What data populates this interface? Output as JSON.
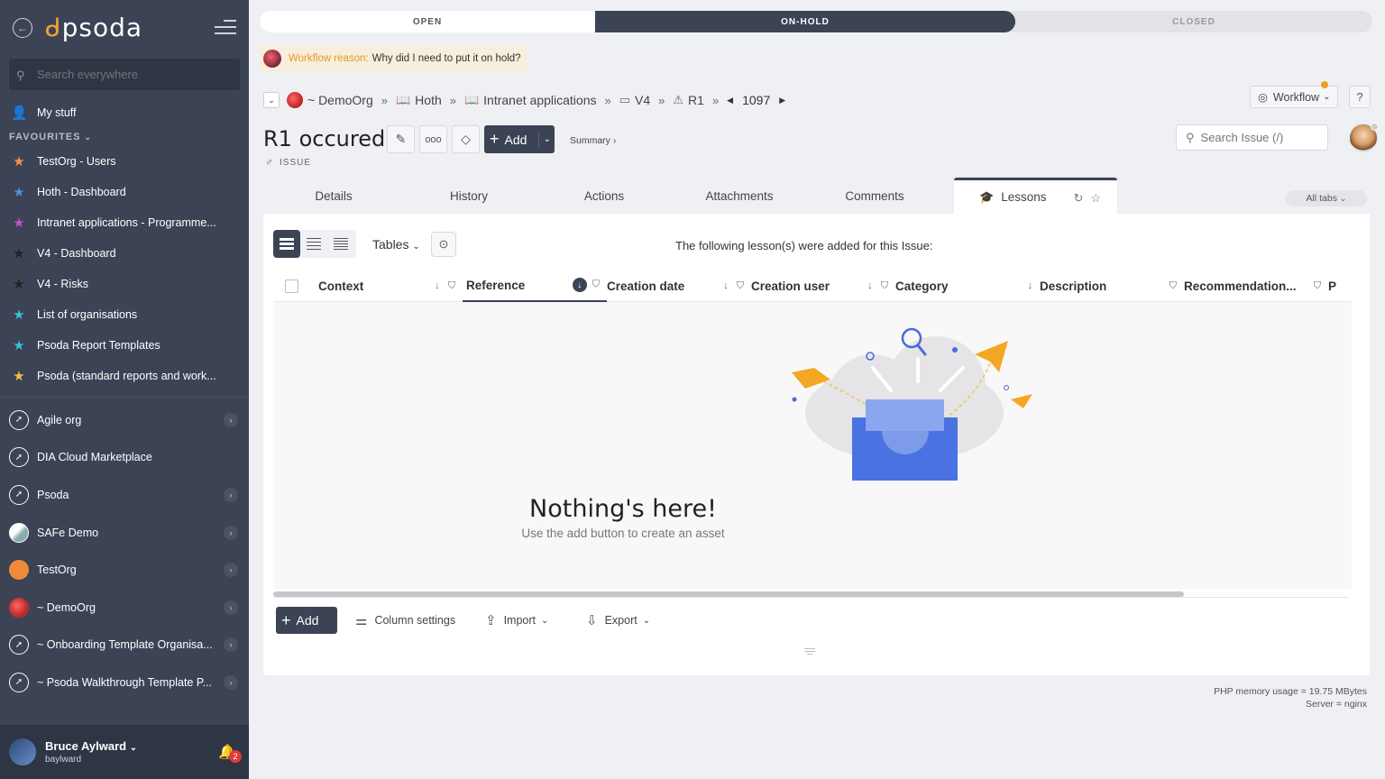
{
  "sidebar": {
    "logo": "psoda",
    "search_placeholder": "Search everywhere",
    "my_stuff": "My stuff",
    "favourites_heading": "FAVOURITES",
    "favourites": [
      {
        "label": "TestOrg - Users",
        "color": "#f0904a"
      },
      {
        "label": "Hoth - Dashboard",
        "color": "#4d8fe0"
      },
      {
        "label": "Intranet applications - Programme...",
        "color": "#c04fc8"
      },
      {
        "label": "V4 - Dashboard",
        "color": "#2a2f3a"
      },
      {
        "label": "V4 - Risks",
        "color": "#2a2f3a"
      },
      {
        "label": "List of organisations",
        "color": "#3bbfd8"
      },
      {
        "label": "Psoda Report Templates",
        "color": "#3bbfd8"
      },
      {
        "label": "Psoda (standard reports and work...",
        "color": "#f0c040"
      }
    ],
    "orgs": [
      {
        "label": "Agile org",
        "chevron": true
      },
      {
        "label": "DIA Cloud Marketplace",
        "chevron": false
      },
      {
        "label": "Psoda",
        "chevron": true
      },
      {
        "label": "SAFe Demo",
        "chevron": true
      },
      {
        "label": "TestOrg",
        "chevron": true
      },
      {
        "label": "~ DemoOrg",
        "chevron": true
      },
      {
        "label": "~ Onboarding Template Organisa...",
        "chevron": true
      },
      {
        "label": "~ Psoda Walkthrough Template P...",
        "chevron": true
      }
    ],
    "user": {
      "name": "Bruce Aylward",
      "username": "baylward",
      "notifications": "2"
    }
  },
  "workflow_stages": {
    "open": "OPEN",
    "on_hold": "ON-HOLD",
    "closed": "CLOSED"
  },
  "reason": {
    "label": "Workflow reason:",
    "text": "Why did I need to put it on hold?"
  },
  "breadcrumb": {
    "org": "~ DemoOrg",
    "items": [
      "Hoth",
      "Intranet applications",
      "V4",
      "R1"
    ],
    "number": "1097"
  },
  "header": {
    "title": "R1 occured",
    "add_label": "Add",
    "summary_link": "Summary ›",
    "type_label": "ISSUE",
    "search_placeholder": "Search Issue (/)",
    "workflow_label": "Workflow",
    "help_label": "?"
  },
  "tabs": [
    "Details",
    "History",
    "Actions",
    "Attachments",
    "Comments",
    "Lessons"
  ],
  "all_tabs": "All tabs",
  "lessons": {
    "tables_label": "Tables",
    "note": "The following lesson(s) were added for this Issue:",
    "columns": [
      "Context",
      "Reference",
      "Creation date",
      "Creation user",
      "Category",
      "Description",
      "Recommendation...",
      "P"
    ],
    "empty_title": "Nothing's here!",
    "empty_sub": "Use the add button to create an asset",
    "add_label": "Add",
    "column_settings": "Column settings",
    "import_label": "Import",
    "export_label": "Export"
  },
  "footer": {
    "memory": "PHP memory usage = 19.75 MBytes",
    "server": "Server = nginx"
  }
}
